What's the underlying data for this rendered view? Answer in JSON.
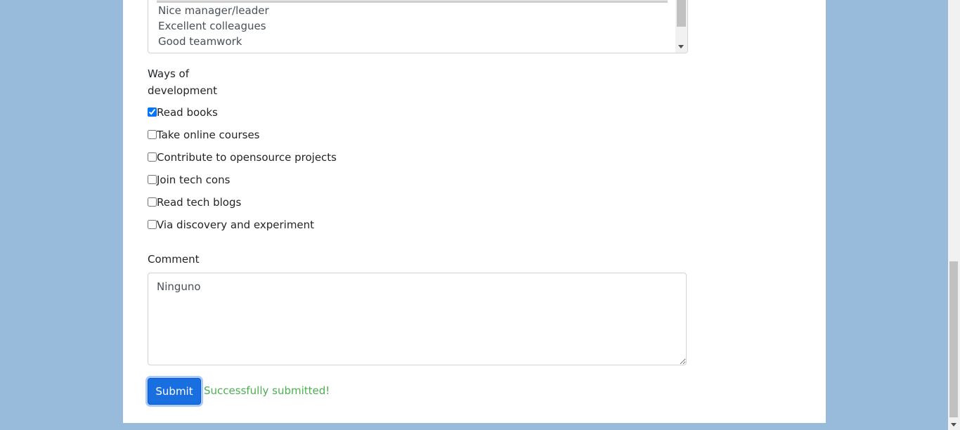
{
  "listbox": {
    "options": [
      "Nice manager/leader",
      "Excellent colleagues",
      "Good teamwork"
    ]
  },
  "development": {
    "label_line1": "Ways of",
    "label_line2": "development",
    "options": [
      {
        "label": "Read books",
        "checked": true
      },
      {
        "label": "Take online courses",
        "checked": false
      },
      {
        "label": "Contribute to opensource projects",
        "checked": false
      },
      {
        "label": "Join tech cons",
        "checked": false
      },
      {
        "label": "Read tech blogs",
        "checked": false
      },
      {
        "label": "Via discovery and experiment",
        "checked": false
      }
    ]
  },
  "comment": {
    "label": "Comment",
    "value": "Ninguno"
  },
  "form": {
    "submit_label": "Submit",
    "success_message": "Successfully submitted!"
  },
  "colors": {
    "page_background": "#99bbdb",
    "primary": "#1a6fe0",
    "success": "#4caf50"
  }
}
